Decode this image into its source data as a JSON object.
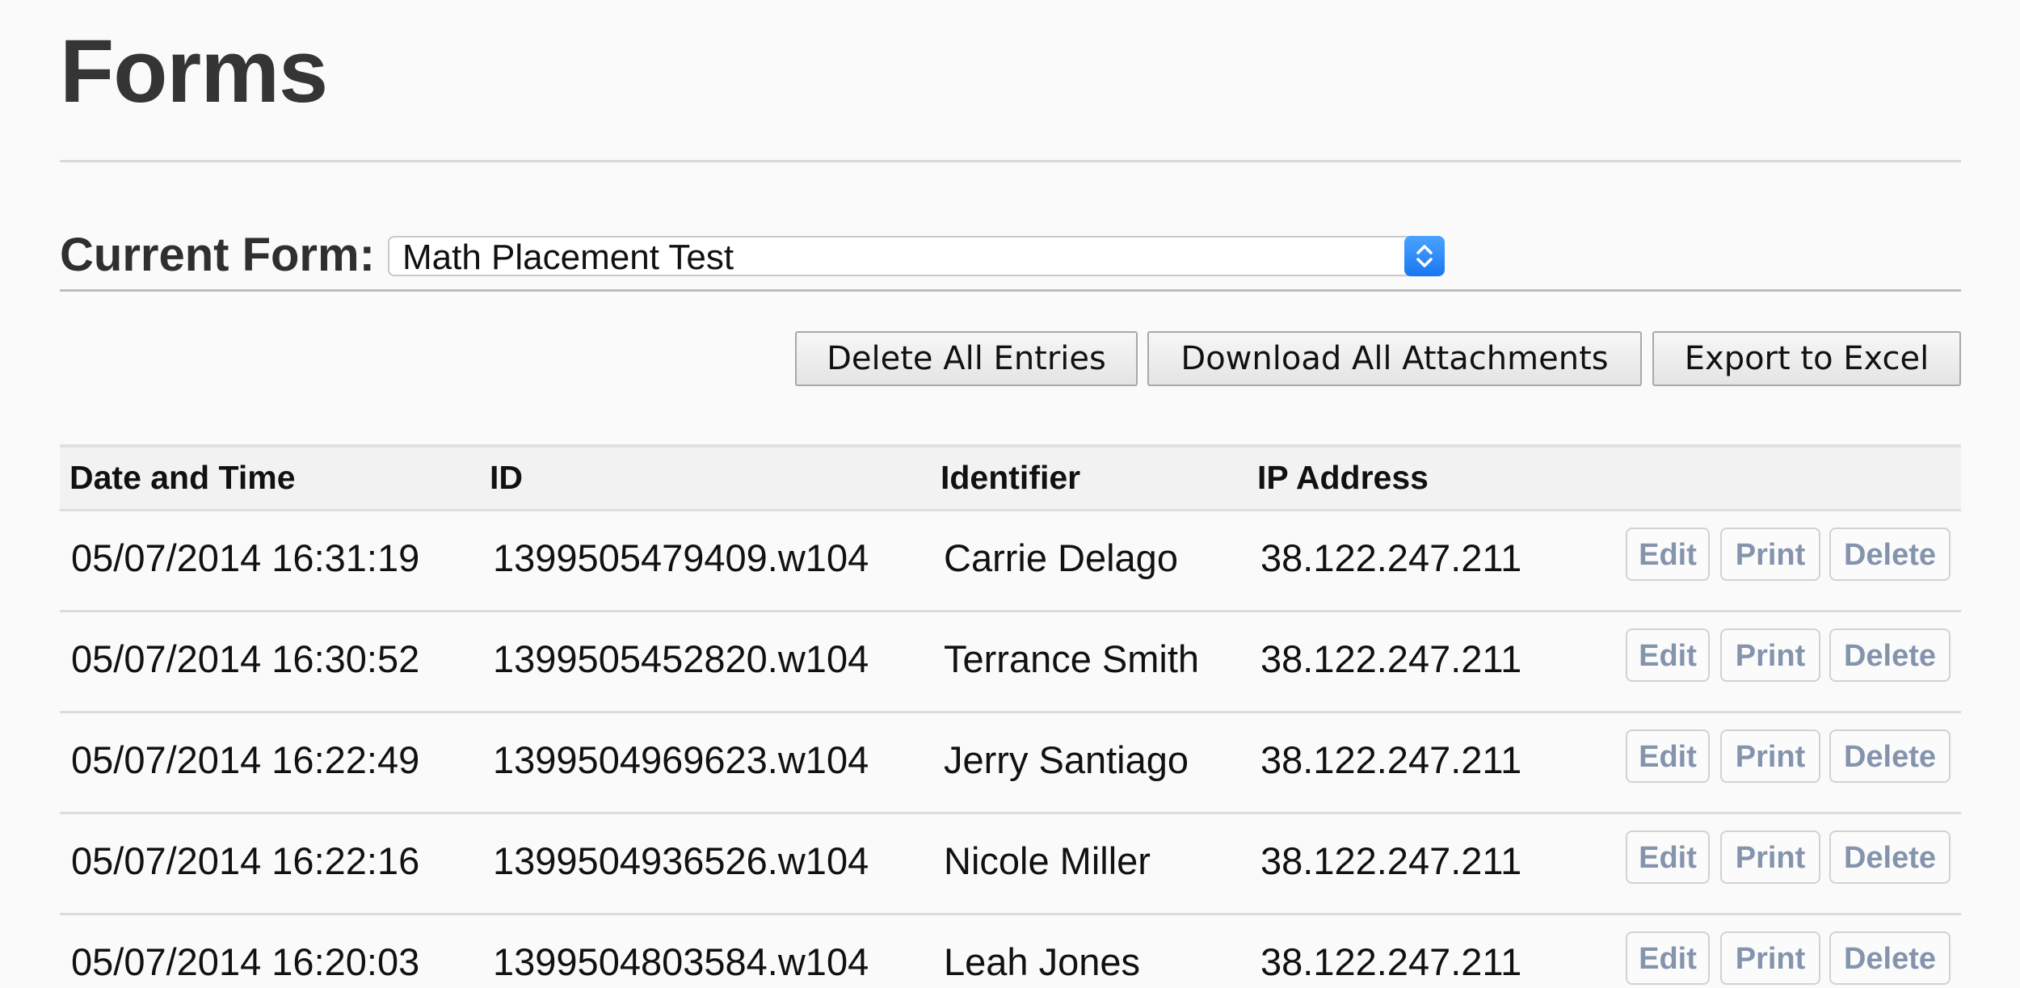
{
  "page": {
    "title": "Forms"
  },
  "form_selector": {
    "label": "Current Form:",
    "selected_value": "Math Placement Test"
  },
  "actions": {
    "delete_all_label": "Delete All Entries",
    "download_attachments_label": "Download All Attachments",
    "export_excel_label": "Export to Excel"
  },
  "table": {
    "headers": {
      "date_time": "Date and Time",
      "id": "ID",
      "identifier": "Identifier",
      "ip_address": "IP Address"
    },
    "row_actions": {
      "edit": "Edit",
      "print": "Print",
      "delete": "Delete"
    },
    "rows": [
      {
        "date_time": "05/07/2014 16:31:19",
        "id": "1399505479409.w104",
        "identifier": "Carrie Delago",
        "ip_address": "38.122.247.211"
      },
      {
        "date_time": "05/07/2014 16:30:52",
        "id": "1399505452820.w104",
        "identifier": "Terrance Smith",
        "ip_address": "38.122.247.211"
      },
      {
        "date_time": "05/07/2014 16:22:49",
        "id": "1399504969623.w104",
        "identifier": "Jerry Santiago",
        "ip_address": "38.122.247.211"
      },
      {
        "date_time": "05/07/2014 16:22:16",
        "id": "1399504936526.w104",
        "identifier": "Nicole Miller",
        "ip_address": "38.122.247.211"
      },
      {
        "date_time": "05/07/2014 16:20:03",
        "id": "1399504803584.w104",
        "identifier": "Leah Jones",
        "ip_address": "38.122.247.211"
      }
    ]
  }
}
